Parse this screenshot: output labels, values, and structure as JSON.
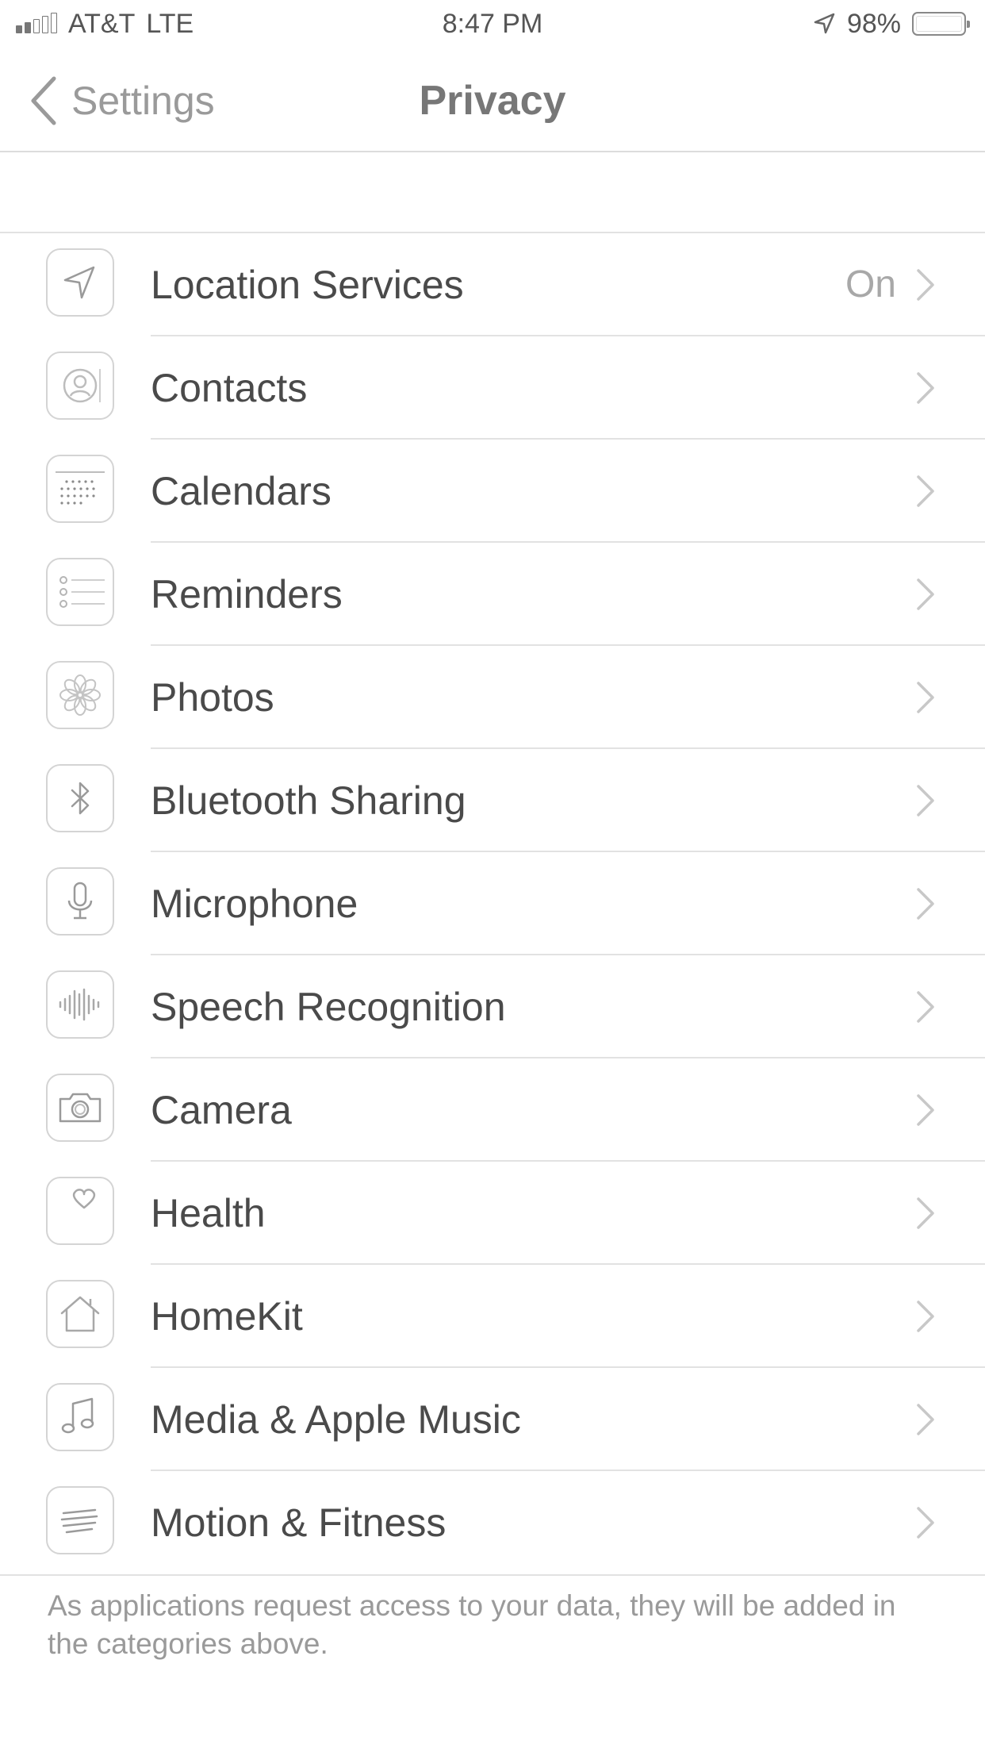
{
  "status_bar": {
    "carrier": "AT&T",
    "network": "LTE",
    "time": "8:47 PM",
    "battery": "98%",
    "battery_level": 0.98,
    "signal_bars_filled": 2,
    "icons": [
      "signal-icon",
      "location-arrow-icon",
      "battery-icon"
    ]
  },
  "nav": {
    "back_label": "Settings",
    "title": "Privacy"
  },
  "items": [
    {
      "label": "Location Services",
      "value": "On",
      "icon": "location-icon"
    },
    {
      "label": "Contacts",
      "value": "",
      "icon": "contacts-icon"
    },
    {
      "label": "Calendars",
      "value": "",
      "icon": "calendar-icon"
    },
    {
      "label": "Reminders",
      "value": "",
      "icon": "reminders-icon"
    },
    {
      "label": "Photos",
      "value": "",
      "icon": "photos-icon"
    },
    {
      "label": "Bluetooth Sharing",
      "value": "",
      "icon": "bluetooth-icon"
    },
    {
      "label": "Microphone",
      "value": "",
      "icon": "microphone-icon"
    },
    {
      "label": "Speech Recognition",
      "value": "",
      "icon": "waveform-icon"
    },
    {
      "label": "Camera",
      "value": "",
      "icon": "camera-icon"
    },
    {
      "label": "Health",
      "value": "",
      "icon": "heart-icon"
    },
    {
      "label": "HomeKit",
      "value": "",
      "icon": "home-icon"
    },
    {
      "label": "Media & Apple Music",
      "value": "",
      "icon": "music-note-icon"
    },
    {
      "label": "Motion & Fitness",
      "value": "",
      "icon": "motion-icon"
    }
  ],
  "footer_note": "As applications request access to your data, they will be added in the categories above.",
  "colors": {
    "text": "#4a4a4a",
    "secondary_text": "#9a9a9a",
    "separator": "#e2e2e2",
    "background": "#ffffff"
  }
}
